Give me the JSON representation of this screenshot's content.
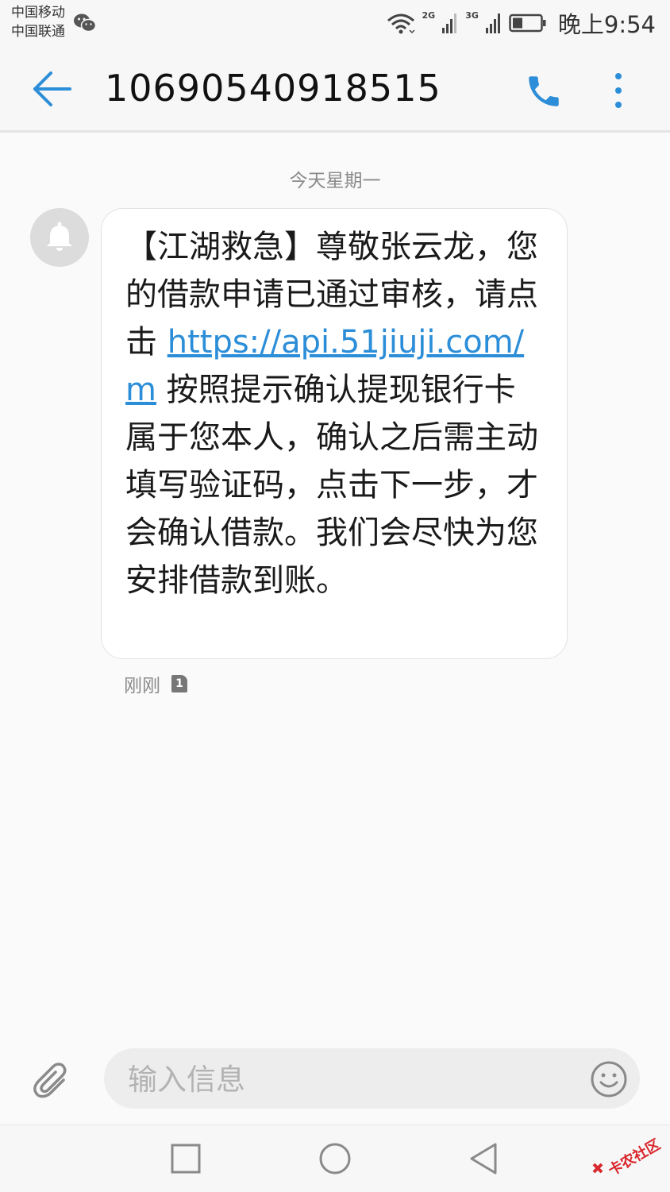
{
  "status_bar": {
    "carrier_1": "中国移动",
    "carrier_2": "中国联通",
    "network_1": "2G",
    "network_2": "3G",
    "time": "晚上9:54",
    "icons": [
      "wechat-icon",
      "wifi-icon",
      "signal-icon",
      "signal-icon",
      "battery-icon"
    ]
  },
  "header": {
    "title": "10690540918515",
    "back_icon": "back-arrow-icon",
    "call_icon": "phone-icon",
    "more_icon": "more-vertical-icon"
  },
  "conversation": {
    "date_separator": "今天星期一",
    "messages": [
      {
        "avatar_icon": "bell-icon",
        "text_before": "【江湖救急】尊敬张云龙，您的借款申请已通过审核，请点击 ",
        "link": "https://api.51jiuji.com/m",
        "text_after": " 按照提示确认提现银行卡属于您本人，确认之后需主动填写验证码，点击下一步，才会确认借款。我们会尽快为您安排借款到账。",
        "time": "刚刚",
        "sim": "1"
      }
    ]
  },
  "composer": {
    "placeholder": "输入信息",
    "attach_icon": "paperclip-icon",
    "emoji_icon": "smiley-icon"
  },
  "nav_bar": {
    "icons": [
      "recents-square-icon",
      "home-circle-icon",
      "back-triangle-icon"
    ]
  },
  "watermark": {
    "text": "卡农社区"
  },
  "colors": {
    "accent": "#2c8ed8",
    "link": "#2c8ed8",
    "background": "#fafafa"
  }
}
